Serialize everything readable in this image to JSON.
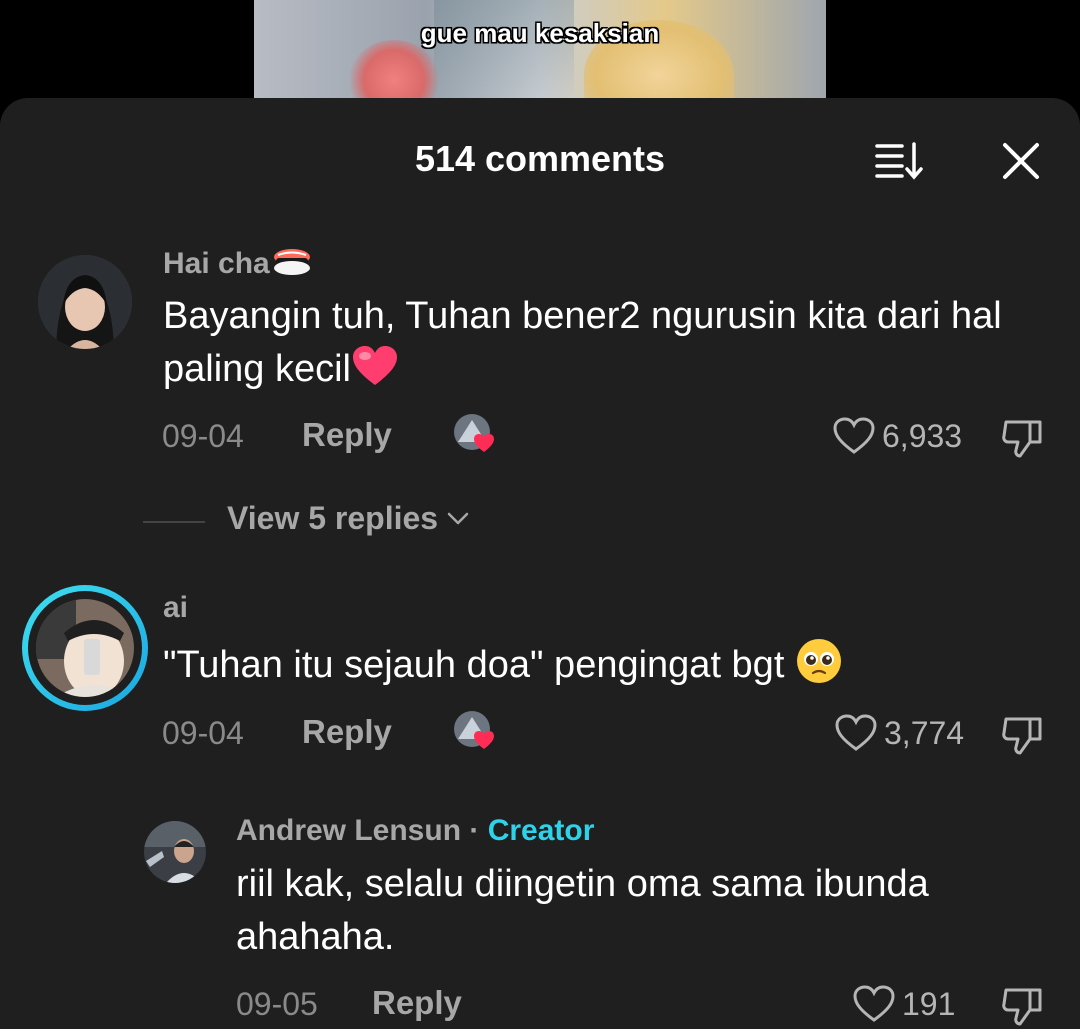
{
  "video": {
    "caption": "gue mau kesaksian"
  },
  "header": {
    "title": "514 comments"
  },
  "icons": {
    "sort": "sort-icon",
    "close": "close-icon",
    "like": "heart-outline-icon",
    "dislike": "thumbs-down-icon"
  },
  "comments": [
    {
      "username": "Hai cha",
      "username_emoji": "sushi",
      "text": "Bayangin tuh, Tuhan bener2 ngurusin kita dari hal paling kecil",
      "text_emoji": "heart",
      "date": "09-04",
      "reply_label": "Reply",
      "likes": "6,933"
    },
    {
      "username": "ai",
      "text": "\"Tuhan itu sejauh doa\" pengingat bgt",
      "text_emoji": "pleading-face",
      "date": "09-04",
      "reply_label": "Reply",
      "likes": "3,774"
    }
  ],
  "view_replies": {
    "label": "View 5 replies"
  },
  "reply": {
    "username": "Andrew Lensun",
    "separator": "·",
    "badge": "Creator",
    "text": "riil kak, selalu diingetin oma sama ibunda ahahaha.",
    "date": "09-05",
    "reply_label": "Reply",
    "likes": "191"
  },
  "colors": {
    "sheet_bg": "#1f1f1f",
    "creator_badge": "#2ed3ea",
    "story_ring": "#2ad4e8",
    "heart_emoji": "#ff3d6e"
  }
}
